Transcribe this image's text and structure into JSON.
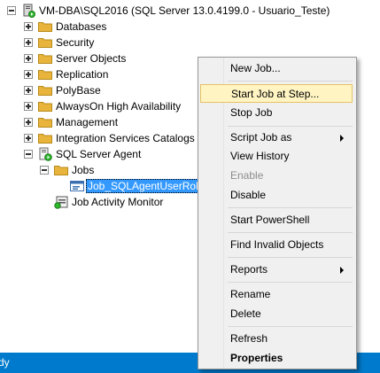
{
  "tree": {
    "root": "VM-DBA\\SQL2016 (SQL Server 13.0.4199.0 - Usuario_Teste)",
    "databases": "Databases",
    "security": "Security",
    "server_objects": "Server Objects",
    "replication": "Replication",
    "polybase": "PolyBase",
    "alwayson": "AlwaysOn High Availability",
    "management": "Management",
    "integration_services": "Integration Services Catalogs",
    "sql_agent": "SQL Server Agent",
    "jobs": "Jobs",
    "selected_job": "Job_SQLAgentUserRole",
    "job_activity_monitor": "Job Activity Monitor"
  },
  "context_menu": {
    "new_job": "New Job...",
    "start_job_at_step": "Start Job at Step...",
    "stop_job": "Stop Job",
    "script_job_as": "Script Job as",
    "view_history": "View History",
    "enable": "Enable",
    "disable": "Disable",
    "start_powershell": "Start PowerShell",
    "find_invalid_objects": "Find Invalid Objects",
    "reports": "Reports",
    "rename": "Rename",
    "delete": "Delete",
    "refresh": "Refresh",
    "properties": "Properties"
  },
  "statusbar": {
    "text": "dy"
  },
  "colors": {
    "statusbar": "#007acc",
    "selection": "#3399ff",
    "folder": "#e8b43c",
    "menu_highlight": "#fff4c2"
  },
  "icons": [
    "server-icon",
    "folder-icon",
    "agent-icon",
    "job-icon",
    "activity-monitor-icon",
    "expand-icon",
    "collapse-icon",
    "submenu-arrow-icon"
  ]
}
